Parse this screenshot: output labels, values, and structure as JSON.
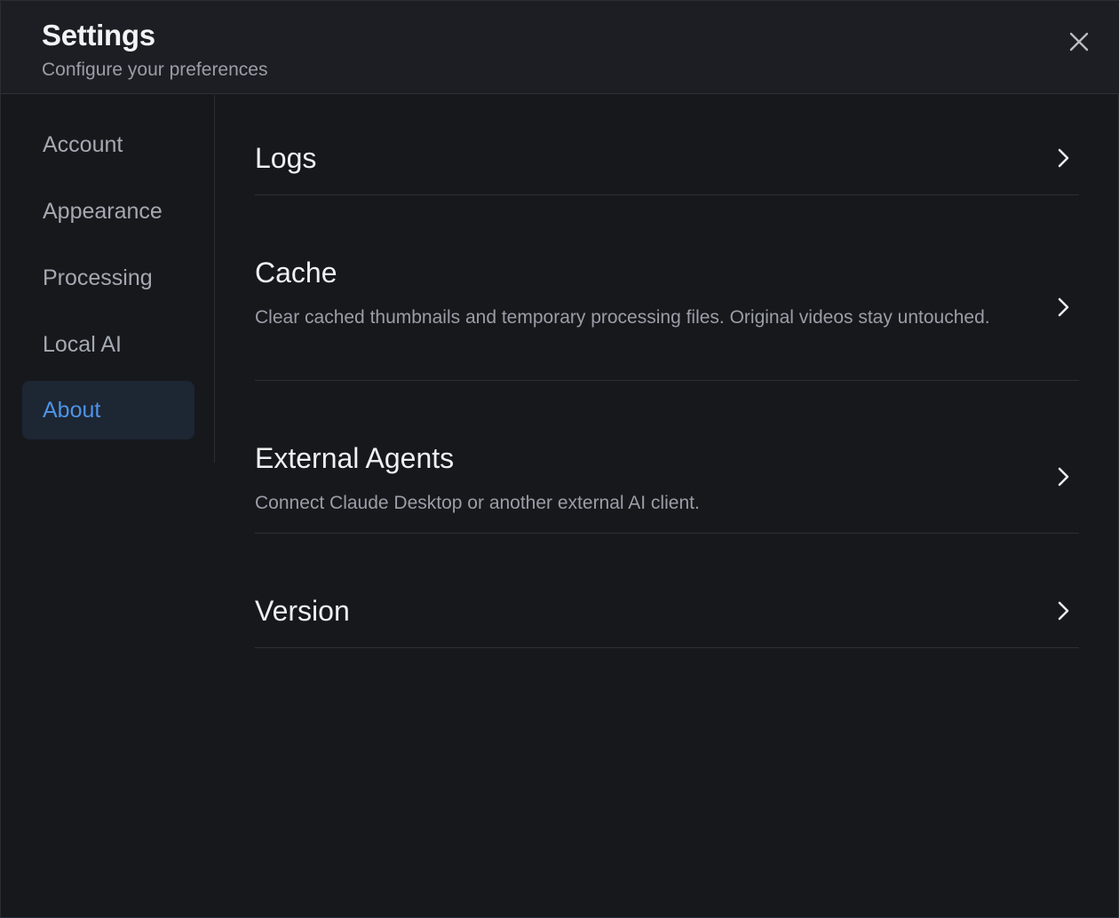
{
  "header": {
    "title": "Settings",
    "subtitle": "Configure your preferences"
  },
  "icons": {
    "close": "close-icon",
    "chevron": "chevron-right-icon"
  },
  "colors": {
    "accent": "#4e93e6",
    "active_bg": "#1d2633",
    "background": "#16181c",
    "header_bg": "#1c1e23"
  },
  "sidebar": {
    "items": [
      {
        "label": "Account",
        "active": false
      },
      {
        "label": "Appearance",
        "active": false
      },
      {
        "label": "Processing",
        "active": false
      },
      {
        "label": "Local AI",
        "active": false
      },
      {
        "label": "About",
        "active": true
      }
    ]
  },
  "main": {
    "rows": [
      {
        "title": "Logs",
        "description": ""
      },
      {
        "title": "Cache",
        "description": "Clear cached thumbnails and temporary processing files. Original videos stay untouched."
      },
      {
        "title": "External Agents",
        "description": "Connect Claude Desktop or another external AI client."
      },
      {
        "title": "Version",
        "description": ""
      }
    ]
  }
}
